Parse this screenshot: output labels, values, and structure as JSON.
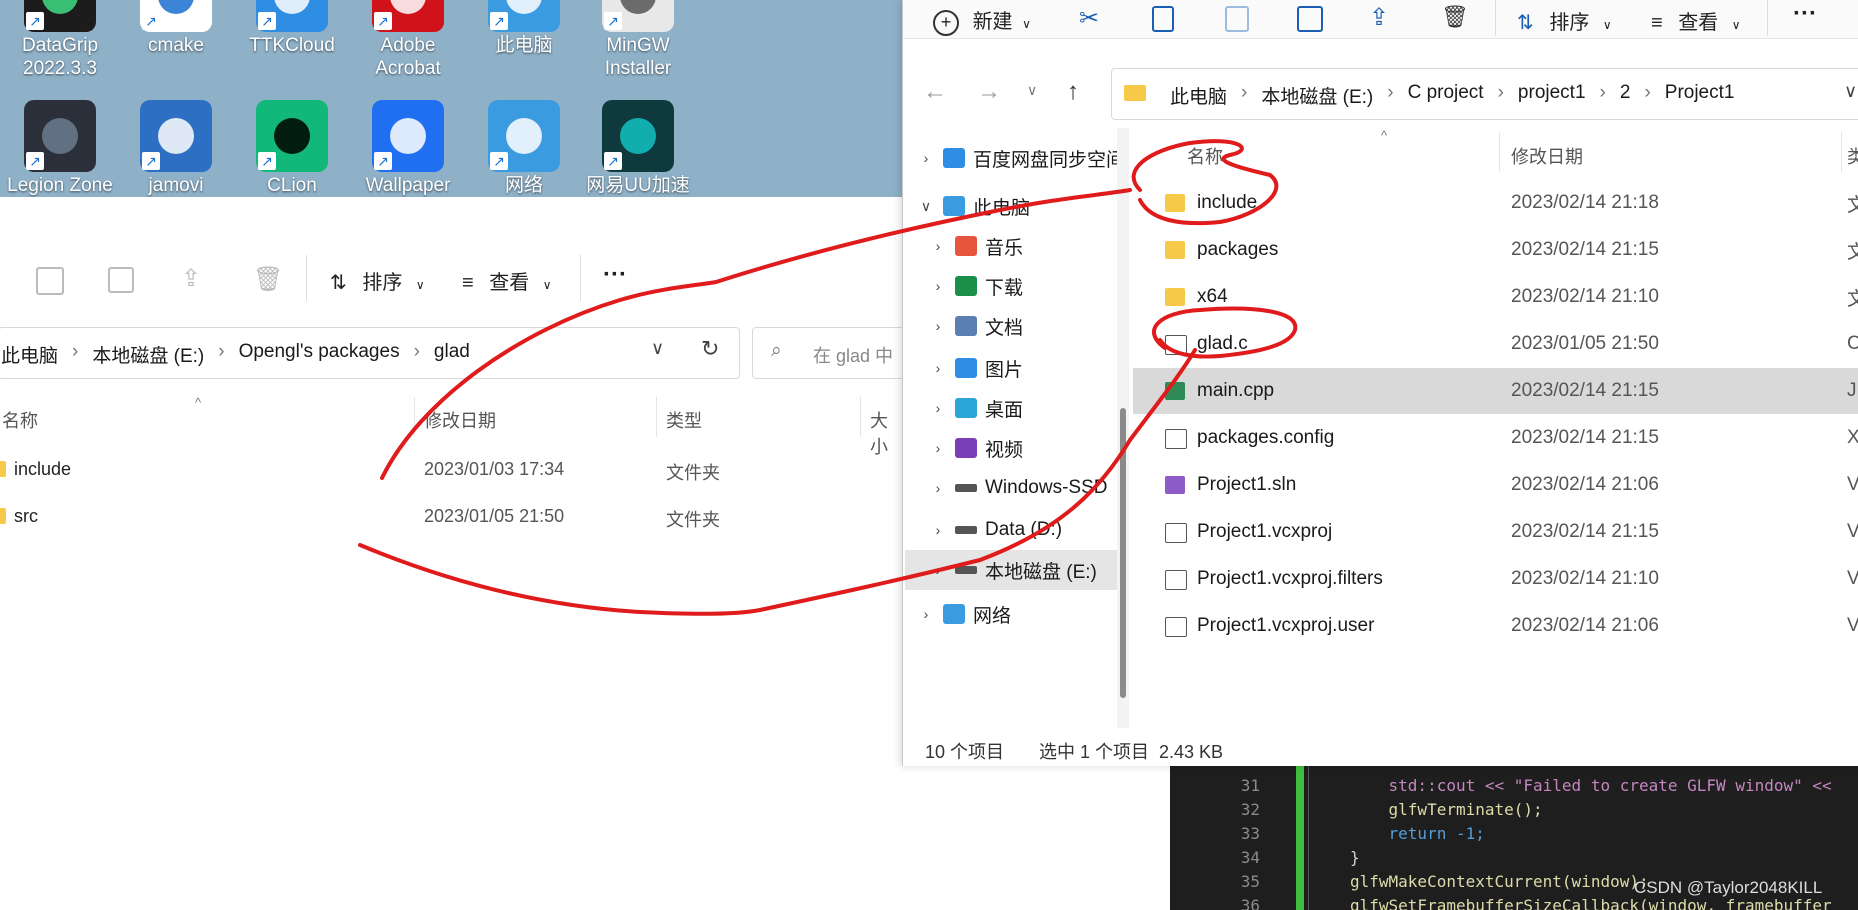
{
  "desktop": {
    "icons": [
      {
        "label": "DataGrip\n2022.3.3",
        "color": "#1c1c1c",
        "accent": "#3ddc84"
      },
      {
        "label": "cmake",
        "color": "#ffffff",
        "accent": "#1a6fd0"
      },
      {
        "label": "TTKCloud",
        "color": "#2f8de4",
        "accent": "#ffffff"
      },
      {
        "label": "Adobe\nAcrobat",
        "color": "#d0121b",
        "accent": "#ffffff"
      },
      {
        "label": "此电脑",
        "color": "#3a9be0",
        "accent": "#ffffff"
      },
      {
        "label": "MinGW\nInstaller",
        "color": "#e8e8e8",
        "accent": "#555555"
      },
      {
        "label": "Legion Zone",
        "color": "#2a2f3a",
        "accent": "#6b7b8f"
      },
      {
        "label": "jamovi",
        "color": "#2d6fc2",
        "accent": "#ffffff"
      },
      {
        "label": "CLion",
        "color": "#11b87a",
        "accent": "#000000"
      },
      {
        "label": "Wallpaper",
        "color": "#1f6ff0",
        "accent": "#ffffff"
      },
      {
        "label": "网络",
        "color": "#3a9be0",
        "accent": "#ffffff"
      },
      {
        "label": "网易UU加速",
        "color": "#0e3a3d",
        "accent": "#13c2c2"
      }
    ]
  },
  "left_explorer": {
    "toolbar": {
      "sort_label": "排序",
      "view_label": "查看",
      "more_label": "···"
    },
    "address": {
      "crumbs": [
        "此电脑",
        "本地磁盘 (E:)",
        "Opengl's packages",
        "glad"
      ],
      "search_placeholder": "在 glad 中"
    },
    "columns": [
      "名称",
      "修改日期",
      "类型",
      "大小"
    ],
    "rows": [
      {
        "name": "include",
        "date": "2023/01/03 17:34",
        "type": "文件夹"
      },
      {
        "name": "src",
        "date": "2023/01/05 21:50",
        "type": "文件夹"
      }
    ]
  },
  "right_explorer": {
    "toolbar": {
      "new_label": "新建",
      "sort_label": "排序",
      "view_label": "查看",
      "more_label": "···"
    },
    "address": {
      "crumbs": [
        "此电脑",
        "本地磁盘 (E:)",
        "C project",
        "project1",
        "2",
        "Project1"
      ]
    },
    "nav": [
      {
        "label": "百度网盘同步空间",
        "color": "#2f8de4"
      },
      {
        "label": "此电脑",
        "color": "#3a9be0"
      },
      {
        "label": "音乐",
        "color": "#e8553e"
      },
      {
        "label": "下载",
        "color": "#1a8f4a"
      },
      {
        "label": "文档",
        "color": "#5b7fb0"
      },
      {
        "label": "图片",
        "color": "#2f8de4"
      },
      {
        "label": "桌面",
        "color": "#2aa7d8"
      },
      {
        "label": "视频",
        "color": "#7a3fb8"
      },
      {
        "label": "Windows-SSD",
        "color": "#555555"
      },
      {
        "label": "Data (D:)",
        "color": "#555555"
      },
      {
        "label": "本地磁盘 (E:)",
        "color": "#555555"
      },
      {
        "label": "网络",
        "color": "#3a9be0"
      }
    ],
    "columns": [
      "名称",
      "修改日期",
      "类"
    ],
    "files": [
      {
        "name": "include",
        "date": "2023/02/14 21:18",
        "type": "文",
        "icon": "folder"
      },
      {
        "name": "packages",
        "date": "2023/02/14 21:15",
        "type": "文",
        "icon": "folder"
      },
      {
        "name": "x64",
        "date": "2023/02/14 21:10",
        "type": "文",
        "icon": "folder"
      },
      {
        "name": "glad.c",
        "date": "2023/01/05 21:50",
        "type": "C",
        "icon": "c-file"
      },
      {
        "name": "main.cpp",
        "date": "2023/02/14 21:15",
        "type": "J",
        "icon": "cpp-file"
      },
      {
        "name": "packages.config",
        "date": "2023/02/14 21:15",
        "type": "X",
        "icon": "config-file"
      },
      {
        "name": "Project1.sln",
        "date": "2023/02/14 21:06",
        "type": "V",
        "icon": "sln-file"
      },
      {
        "name": "Project1.vcxproj",
        "date": "2023/02/14 21:15",
        "type": "V",
        "icon": "vcxproj-file"
      },
      {
        "name": "Project1.vcxproj.filters",
        "date": "2023/02/14 21:10",
        "type": "V",
        "icon": "filters-file"
      },
      {
        "name": "Project1.vcxproj.user",
        "date": "2023/02/14 21:06",
        "type": "V",
        "icon": "user-file"
      }
    ],
    "status": {
      "count": "10 个项目",
      "selection": "选中 1 个项目  2.43 KB"
    }
  },
  "code": {
    "lines": [
      {
        "n": "31",
        "text": "    std::cout << \"Failed to create GLFW window\" <<"
      },
      {
        "n": "32",
        "text": "    glfwTerminate();"
      },
      {
        "n": "33",
        "text": "    return -1;"
      },
      {
        "n": "34",
        "text": "}"
      },
      {
        "n": "35",
        "text": "glfwMakeContextCurrent(window);"
      },
      {
        "n": "36",
        "text": "glfwSetFramebufferSizeCallback(window, framebuffer"
      }
    ]
  },
  "watermark": "CSDN @Taylor2048KILL",
  "annotation_color": "#e01b1b"
}
